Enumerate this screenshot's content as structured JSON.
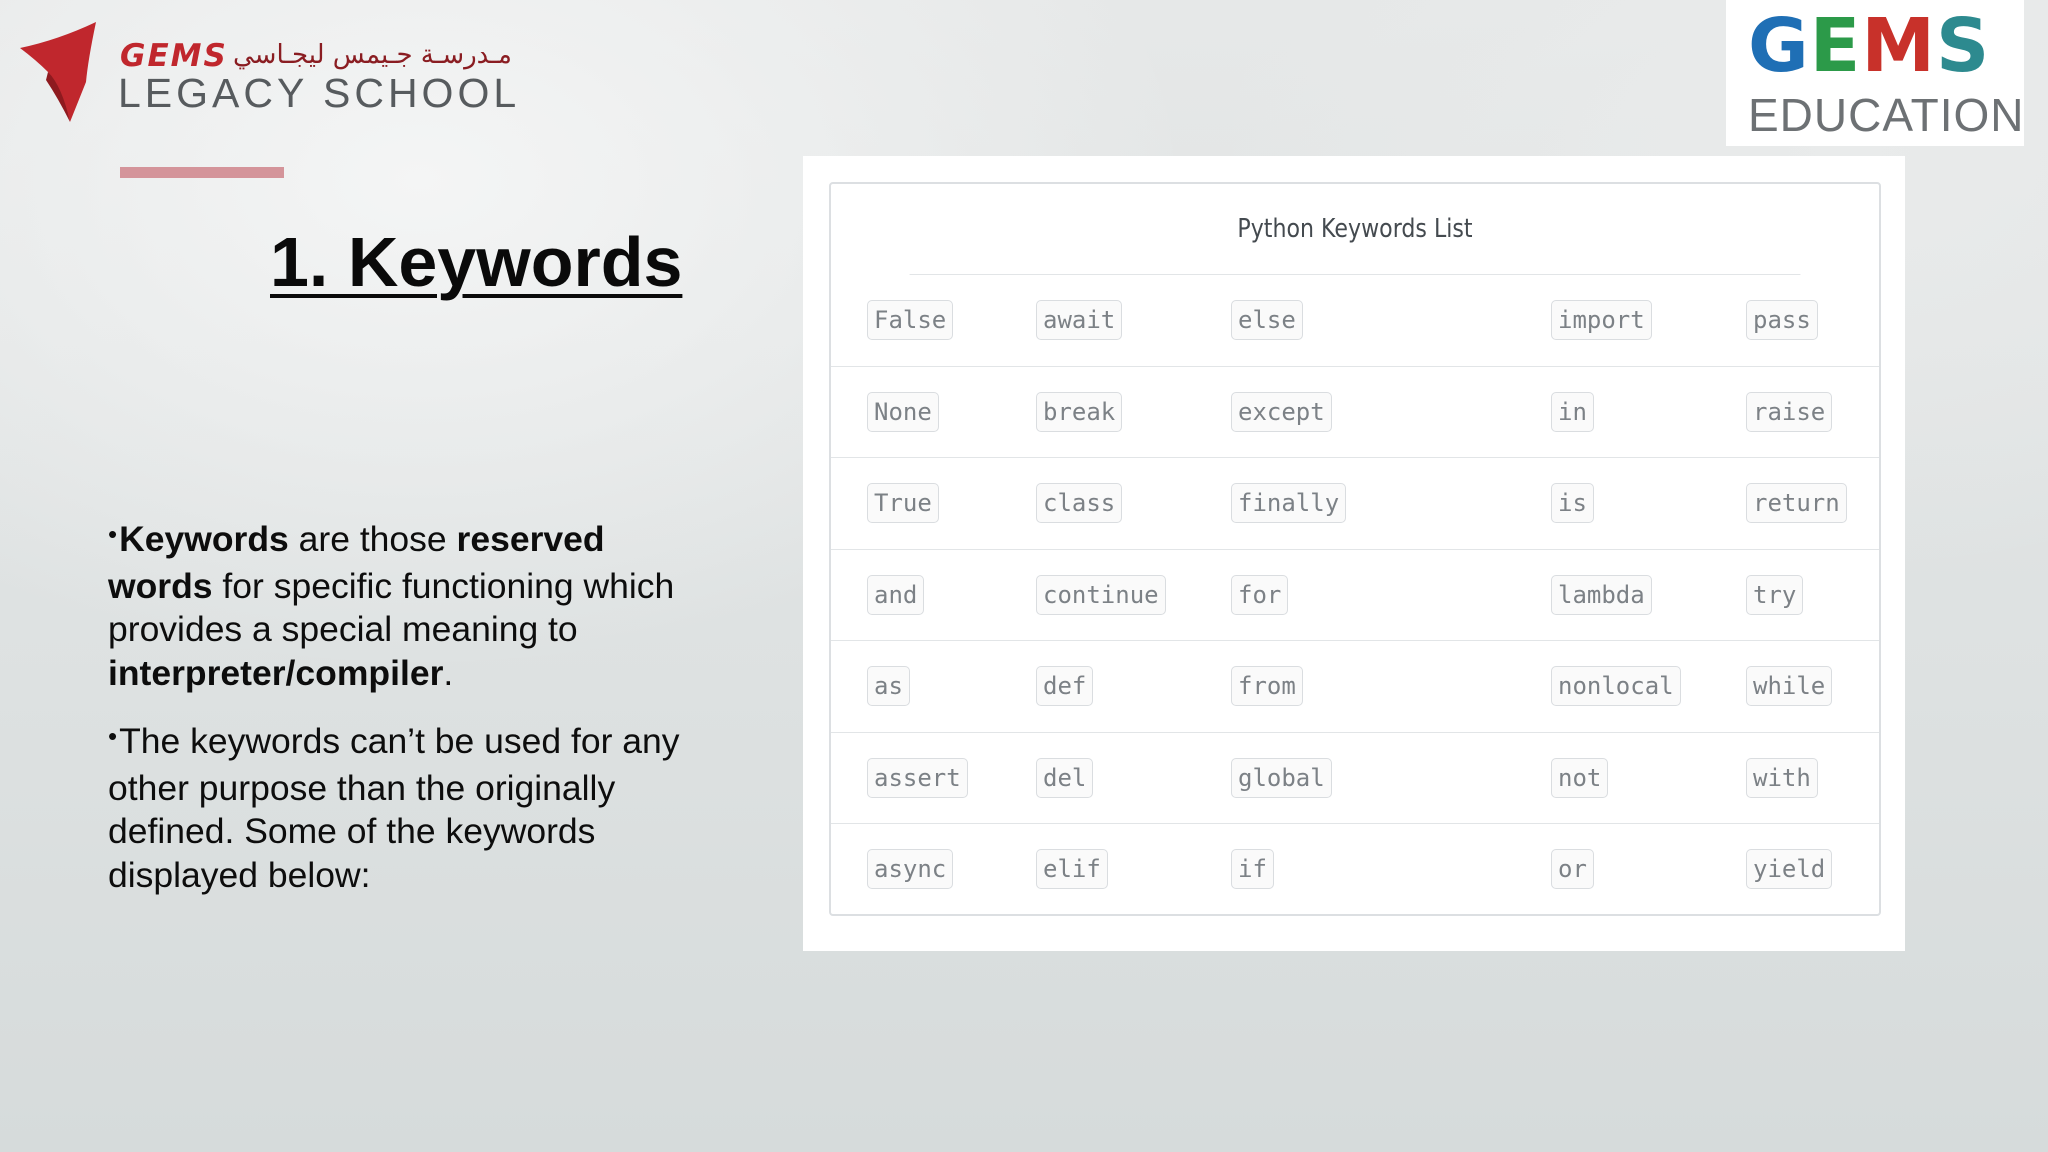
{
  "header": {
    "left_logo": {
      "brand": "GEMS",
      "arabic": "مـدرسـة جـيمس ليجـاسي",
      "school": "LEGACY SCHOOL"
    },
    "right_logo": {
      "letters": [
        "G",
        "E",
        "M",
        "S"
      ],
      "subtitle": "EDUCATION"
    }
  },
  "slide": {
    "title": "1. Keywords",
    "paragraph1": {
      "p1": "Keywords",
      "p2": " are those ",
      "p3": "reserved words",
      "p4": " for specific functioning which provides a special meaning to ",
      "p5": "interpreter/compiler",
      "p6": "."
    },
    "paragraph2": "The keywords can’t be used for any other purpose than the originally defined. Some of the keywords displayed below:",
    "bullet_symbol": "•"
  },
  "keywords_table": {
    "caption": "Python Keywords List",
    "rows": [
      [
        "False",
        "await",
        "else",
        "import",
        "pass"
      ],
      [
        "None",
        "break",
        "except",
        "in",
        "raise"
      ],
      [
        "True",
        "class",
        "finally",
        "is",
        "return"
      ],
      [
        "and",
        "continue",
        "for",
        "lambda",
        "try"
      ],
      [
        "as",
        "def",
        "from",
        "nonlocal",
        "while"
      ],
      [
        "assert",
        "del",
        "global",
        "not",
        "with"
      ],
      [
        "async",
        "elif",
        "if",
        "or",
        "yield"
      ]
    ]
  },
  "colors": {
    "accent_bar": "#d4949a",
    "gems_red": "#c0272d",
    "gems_blue": "#1f6fb5",
    "gems_green": "#2c9a49"
  }
}
